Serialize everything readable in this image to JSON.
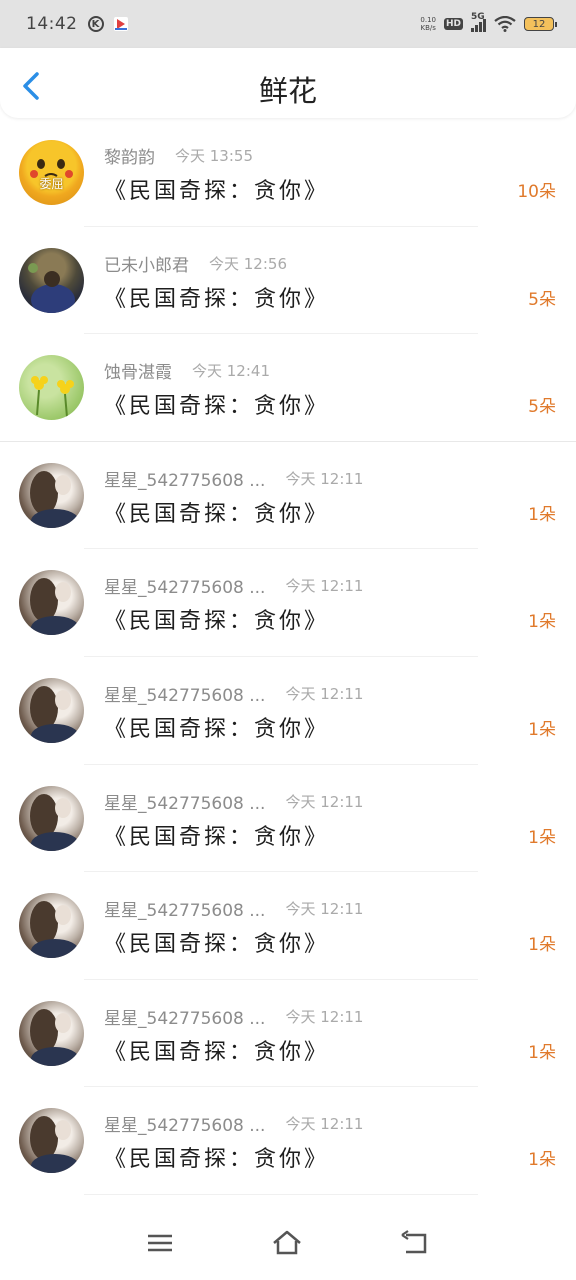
{
  "status_bar": {
    "time": "14:42",
    "k_badge": "K",
    "net_speed": "0.10",
    "net_unit": "KB/s",
    "hd": "HD",
    "network": "5G",
    "battery": "12"
  },
  "header": {
    "title": "鲜花",
    "back_icon": "chevron-left-icon"
  },
  "items": [
    {
      "name": "黎韵韵",
      "time": "今天 13:55",
      "book": "《民国奇探：贪你》",
      "count": "10朵",
      "avatar": "pikachu",
      "avatar_text": "委屈"
    },
    {
      "name": "已未小郎君",
      "time": "今天 12:56",
      "book": "《民国奇探：贪你》",
      "count": "5朵",
      "avatar": "dark-photo"
    },
    {
      "name": "蚀骨湛霞",
      "time": "今天 12:41",
      "book": "《民国奇探：贪你》",
      "count": "5朵",
      "avatar": "flowers"
    },
    {
      "name": "星星_542775608 ...",
      "time": "今天 12:11",
      "book": "《民国奇探：贪你》",
      "count": "1朵",
      "avatar": "girl"
    },
    {
      "name": "星星_542775608 ...",
      "time": "今天 12:11",
      "book": "《民国奇探：贪你》",
      "count": "1朵",
      "avatar": "girl"
    },
    {
      "name": "星星_542775608 ...",
      "time": "今天 12:11",
      "book": "《民国奇探：贪你》",
      "count": "1朵",
      "avatar": "girl"
    },
    {
      "name": "星星_542775608 ...",
      "time": "今天 12:11",
      "book": "《民国奇探：贪你》",
      "count": "1朵",
      "avatar": "girl"
    },
    {
      "name": "星星_542775608 ...",
      "time": "今天 12:11",
      "book": "《民国奇探：贪你》",
      "count": "1朵",
      "avatar": "girl"
    },
    {
      "name": "星星_542775608 ...",
      "time": "今天 12:11",
      "book": "《民国奇探：贪你》",
      "count": "1朵",
      "avatar": "girl"
    },
    {
      "name": "星星_542775608 ...",
      "time": "今天 12:11",
      "book": "《民国奇探：贪你》",
      "count": "1朵",
      "avatar": "girl"
    }
  ],
  "nav": {
    "menu_icon": "menu-icon",
    "home_icon": "home-icon",
    "back_icon": "back-icon"
  },
  "colors": {
    "accent": "#2b8ee6",
    "count": "#e07a2c",
    "name": "#8c8c8c",
    "time": "#aaaaaa"
  }
}
